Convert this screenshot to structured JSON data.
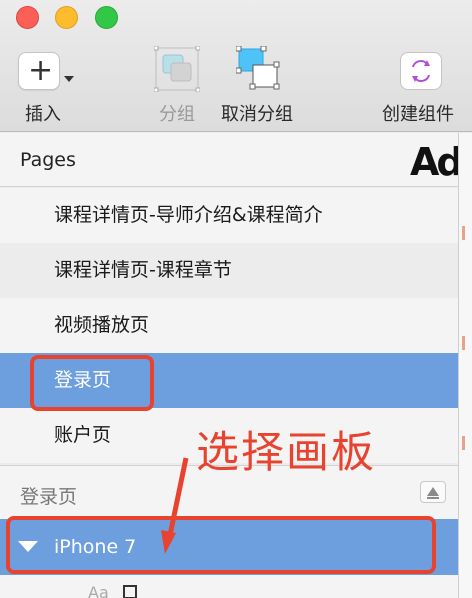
{
  "toolbar": {
    "insert": {
      "label": "插入",
      "icon": "plus-icon"
    },
    "group": {
      "label": "分组",
      "icon": "group-icon",
      "enabled": false
    },
    "ungroup": {
      "label": "取消分组",
      "icon": "ungroup-icon"
    },
    "create_component": {
      "label": "创建组件",
      "icon": "create-symbol-icon"
    }
  },
  "pages": {
    "title": "Pages",
    "items": [
      {
        "label": "课程详情页-导师介绍&课程简介",
        "selected": false
      },
      {
        "label": "课程详情页-课程章节",
        "selected": false
      },
      {
        "label": "视频播放页",
        "selected": false
      },
      {
        "label": "登录页",
        "selected": true
      },
      {
        "label": "账户页",
        "selected": false
      }
    ]
  },
  "layers": {
    "title": "登录页",
    "artboard": "iPhone 7"
  },
  "annotation": {
    "text": "选择画板",
    "color": "#e8432f"
  },
  "colors": {
    "selection": "#6d9fde",
    "accent_red": "#e8432f"
  }
}
